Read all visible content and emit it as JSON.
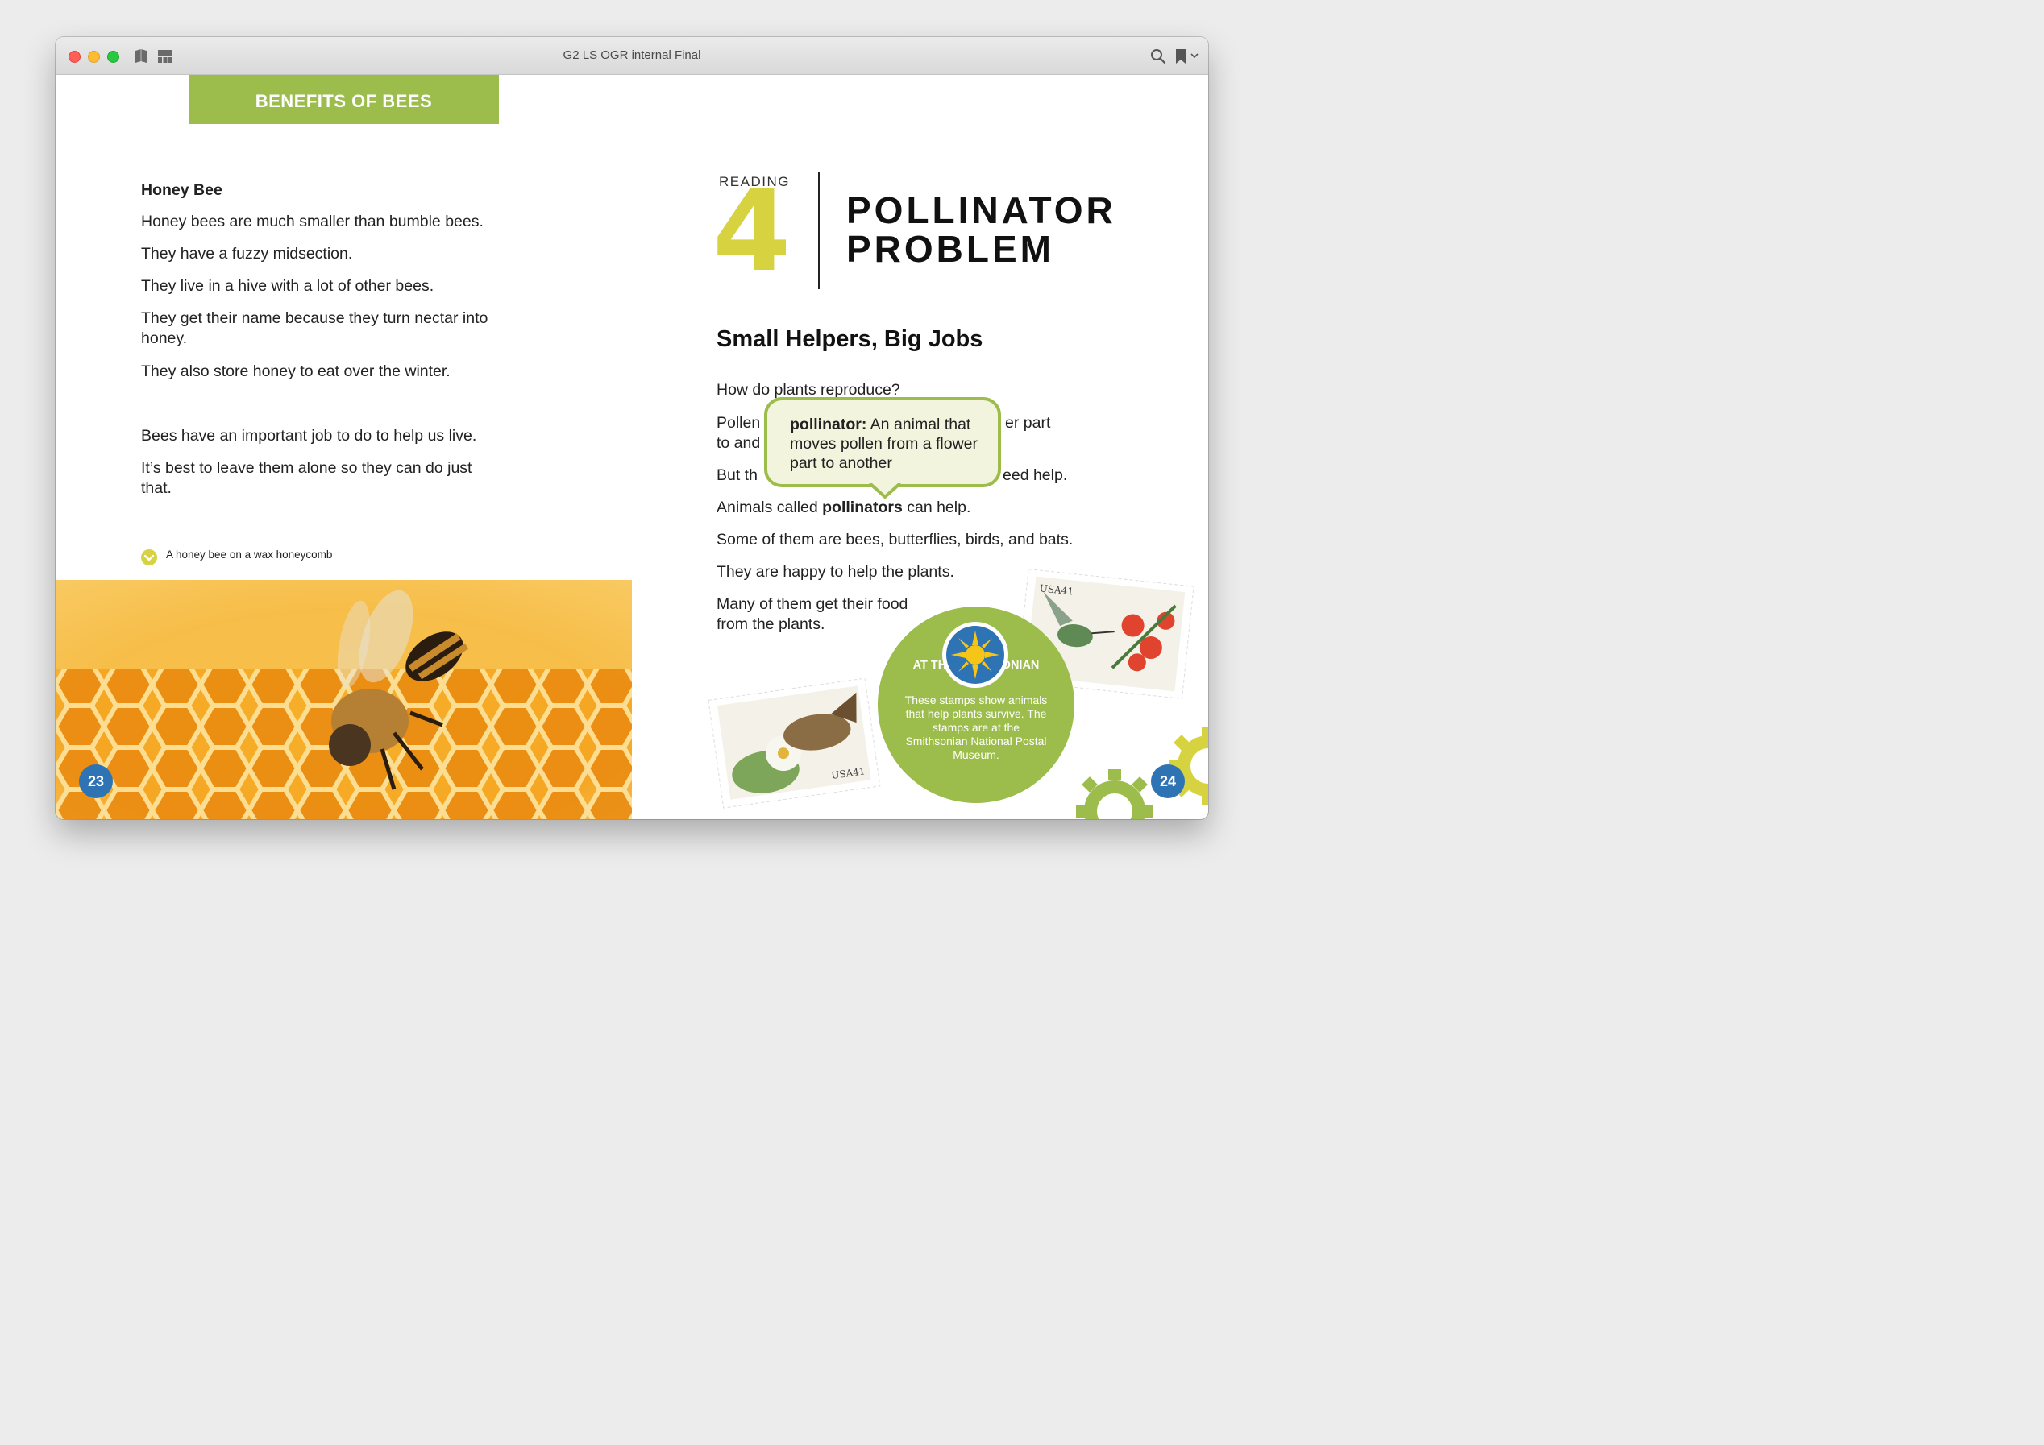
{
  "window": {
    "title": "G2 LS OGR internal Final"
  },
  "toolbar_icons": [
    "book-icon",
    "grid-view-icon",
    "search-icon",
    "bookmark-icon",
    "chevron-down-icon"
  ],
  "left_page": {
    "banner": "BENEFITS OF BEES",
    "heading": "Honey Bee",
    "paragraphs": [
      "Honey bees are much smaller than bumble bees.",
      "They have a fuzzy midsection.",
      "They live in a hive with a lot of other bees.",
      "They get their name because they turn nectar into honey.",
      "They also store honey to eat over the winter.",
      "Bees have an important job to do to help us live.",
      "It’s best to leave them alone so they can do just that."
    ],
    "caption": "A honey bee on a wax honeycomb",
    "page_number": "23"
  },
  "right_page": {
    "reading_label": "READING",
    "reading_number": "4",
    "title_line1": "POLLINATOR",
    "title_line2": "PROBLEM",
    "subheading": "Small Helpers, Big Jobs",
    "paragraphs": [
      "How do plants reproduce?",
      "Pollen",
      "er part",
      "to and",
      "But th",
      "eed help."
    ],
    "pollinators_sentence": {
      "before": "Animals called ",
      "bold": "pollinators",
      "after": " can help."
    },
    "more_paragraphs": [
      "Some of them are bees, butterflies, birds, and bats.",
      "They are happy to help the plants.",
      "Many of them get their food from the plants."
    ],
    "tooltip": {
      "term": "pollinator:",
      "definition": " An animal that moves pollen from a flower part to another"
    },
    "smithsonian": {
      "title": "AT THE SMITHSONIAN",
      "body": "These stamps show animals that help plants survive. The stamps are at the Smithsonian National Postal Museum."
    },
    "stamp_labels": [
      "USA41",
      "USA41"
    ],
    "page_number": "24"
  },
  "colors": {
    "accent_green": "#9cbc4c",
    "number_yellow": "#d6d240",
    "page_number_blue": "#2e74b5"
  }
}
